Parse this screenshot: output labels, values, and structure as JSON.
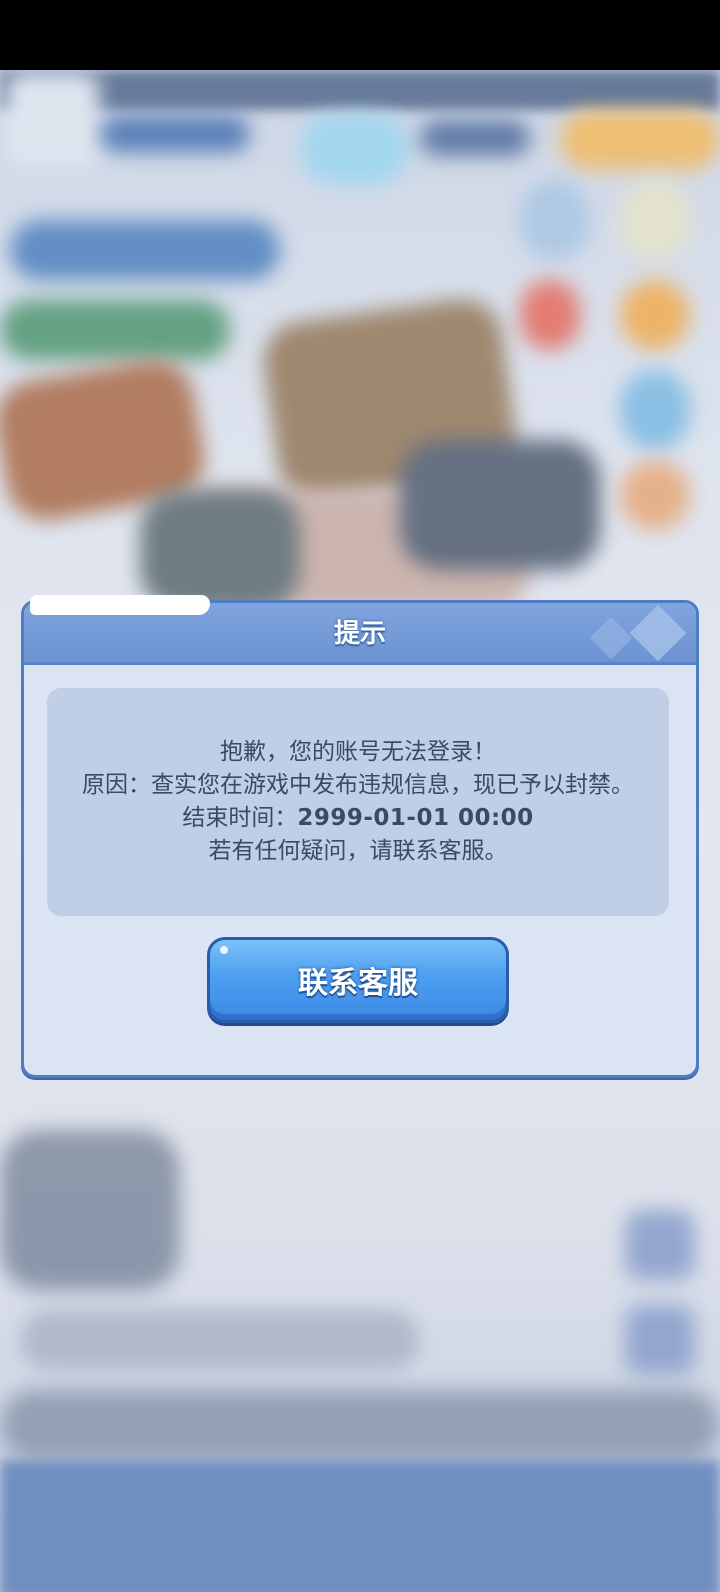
{
  "dialog": {
    "title": "提示",
    "message": {
      "line1": "抱歉，您的账号无法登录！",
      "line2": "原因：查实您在游戏中发布违规信息，现已予以封禁。",
      "end_time_label": "结束时间：",
      "end_time_value": "2999-01-01 00:00",
      "line4": "若有任何疑问，请联系客服。"
    },
    "button_label": "联系客服"
  },
  "colors": {
    "dialog_header": "#6c93d2",
    "dialog_body": "#dbe4f3",
    "message_box": "#c1cfe6",
    "button": "#4d9ff0"
  }
}
